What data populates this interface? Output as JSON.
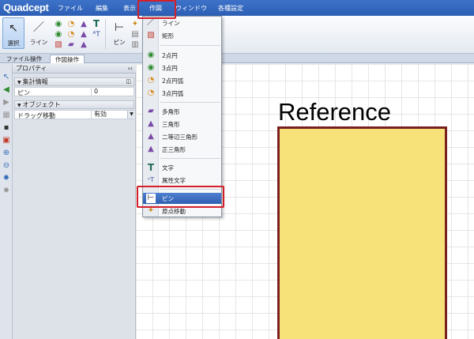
{
  "app": {
    "logo": "Quadcept"
  },
  "menubar": {
    "items": [
      "ファイル",
      "編集",
      "表示",
      "作図",
      "ウィンドウ",
      "各種設定"
    ]
  },
  "ribbon": {
    "select_label": "選択",
    "line_label": "ライン",
    "pin_label": "ピン",
    "tabs": [
      "ファイル操作",
      "作図操作"
    ]
  },
  "panel": {
    "title": "プロパティ",
    "title_pin": "‹‹",
    "section1": "集計情報",
    "pin_key": "ピン",
    "pin_value": "0",
    "section2": "オブジェクト",
    "drag_key": "ドラッグ移動",
    "drag_value": "有効"
  },
  "canvas": {
    "reference_text": "Reference"
  },
  "dropdown": {
    "items": [
      {
        "label": "ライン",
        "icon": "line-icon"
      },
      {
        "label": "矩形",
        "icon": "rectangle-icon"
      },
      {
        "label": "2点円",
        "icon": "circle-2pt-icon"
      },
      {
        "label": "3点円",
        "icon": "circle-3pt-icon"
      },
      {
        "label": "2点円弧",
        "icon": "arc-2pt-icon"
      },
      {
        "label": "3点円弧",
        "icon": "arc-3pt-icon"
      },
      {
        "label": "多角形",
        "icon": "polygon-icon"
      },
      {
        "label": "三角形",
        "icon": "triangle-icon"
      },
      {
        "label": "二等辺三角形",
        "icon": "isosceles-triangle-icon"
      },
      {
        "label": "正三角形",
        "icon": "equilateral-triangle-icon"
      },
      {
        "label": "文字",
        "icon": "text-icon"
      },
      {
        "label": "属性文字",
        "icon": "attribute-text-icon"
      },
      {
        "label": "ピン",
        "icon": "pin-icon"
      },
      {
        "label": "原点移動",
        "icon": "origin-move-icon"
      }
    ],
    "highlighted": "ピン"
  },
  "colors": {
    "menubar": "#2c5fb4",
    "highlight_box": "#d4202a",
    "shape_fill": "#f7e27a",
    "shape_border": "#7a1f1f",
    "menu_highlight": "#2f5fb0"
  }
}
